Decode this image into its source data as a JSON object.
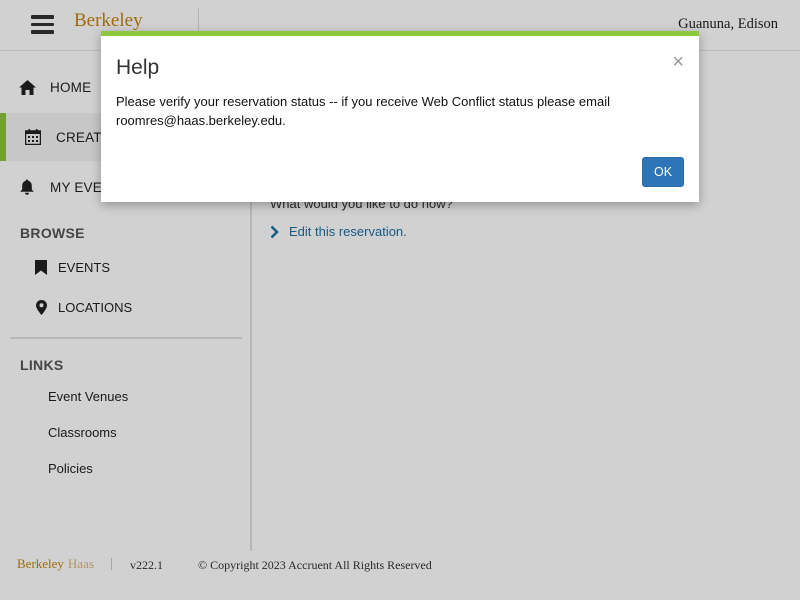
{
  "header": {
    "logo": "Berkeley",
    "user_name": "Guanuna, Edison"
  },
  "sidebar": {
    "nav": [
      {
        "label": "HOME",
        "icon": "home-icon"
      },
      {
        "label": "CREATE",
        "icon": "calendar-icon"
      },
      {
        "label": "MY EVEN",
        "icon": "bell-icon"
      }
    ],
    "browse_title": "BROWSE",
    "browse": [
      {
        "label": "EVENTS",
        "icon": "bookmark-icon"
      },
      {
        "label": "LOCATIONS",
        "icon": "map-marker-icon"
      }
    ],
    "links_title": "LINKS",
    "links": [
      "Event Venues",
      "Classrooms",
      "Policies"
    ]
  },
  "main": {
    "prompt": "What would you like to do now?",
    "edit_link": "Edit this reservation."
  },
  "footer": {
    "logo": "Berkeley",
    "logo_suffix": "Haas",
    "version": "v222.1",
    "copyright": "© Copyright 2023 Accruent All Rights Reserved"
  },
  "modal": {
    "title": "Help",
    "close": "×",
    "body": "Please verify your reservation status -- if you receive Web Conflict status please email roomres@haas.berkeley.edu.",
    "ok_label": "OK"
  },
  "colors": {
    "accent_green": "#8dc63f",
    "link_blue": "#1c6ea4",
    "button_blue": "#2d75b6",
    "brand_gold": "#c4820e"
  }
}
